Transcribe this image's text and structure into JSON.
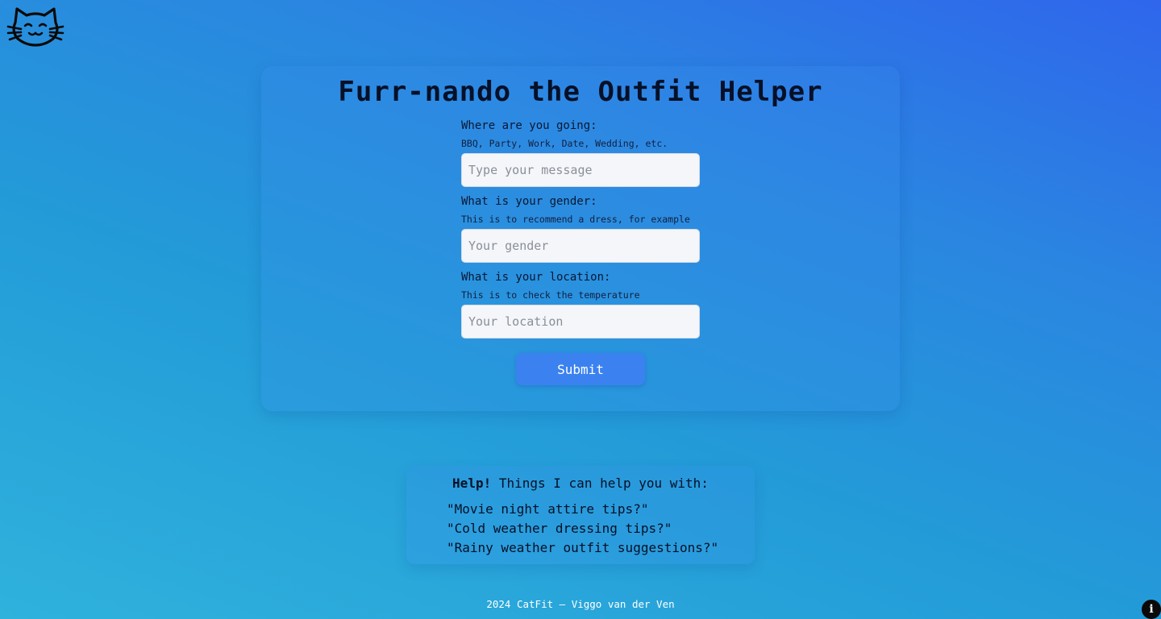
{
  "logo": {
    "icon": "cat-face-icon"
  },
  "title": "Furr-nando the Outfit Helper",
  "form": {
    "fields": [
      {
        "label": "Where are you going:",
        "hint": "BBQ, Party, Work, Date, Wedding, etc.",
        "placeholder": "Type your message",
        "value": ""
      },
      {
        "label": "What is your gender:",
        "hint": "This is to recommend a dress, for example",
        "placeholder": "Your gender",
        "value": ""
      },
      {
        "label": "What is your location:",
        "hint": "This is to check the temperature",
        "placeholder": "Your location",
        "value": ""
      }
    ],
    "submit_label": "Submit"
  },
  "help": {
    "bold": "Help!",
    "rest": " Things I can help you with:",
    "items": [
      "\"Movie night attire tips?\"",
      "\"Cold weather dressing tips?\"",
      "\"Rainy weather outfit suggestions?\""
    ]
  },
  "footer": "2024 CatFit – Viggo van der Ven",
  "info_icon": {
    "glyph": "i",
    "icon": "info-icon"
  },
  "colors": {
    "background_top": "#2f66ec",
    "background_bottom": "#2fb2dc",
    "submit": "#3b82f0",
    "input_bg": "#f4f6fa"
  }
}
